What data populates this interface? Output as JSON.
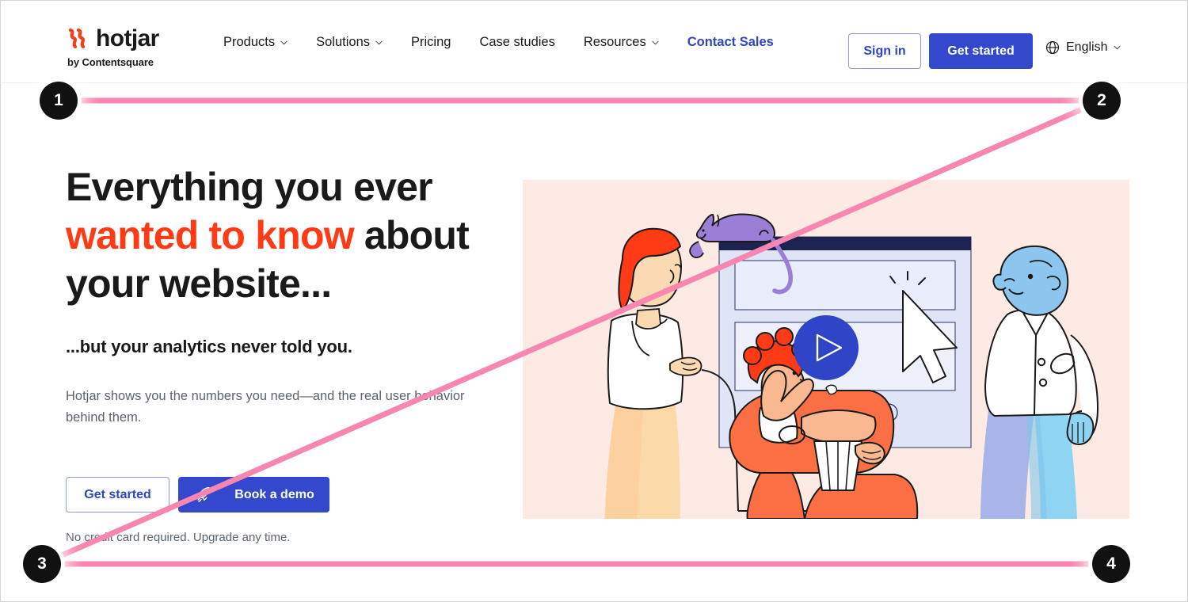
{
  "header": {
    "logo": {
      "mark": "hotjar-flame-icon",
      "wordmark": "hotjar",
      "byline": "by Contentsquare"
    },
    "nav_items": [
      {
        "label": "Products",
        "has_dropdown": true,
        "icon": "chevron-down-icon"
      },
      {
        "label": "Solutions",
        "has_dropdown": true,
        "icon": "chevron-down-icon"
      },
      {
        "label": "Pricing",
        "has_dropdown": false,
        "icon": ""
      },
      {
        "label": "Case studies",
        "has_dropdown": false,
        "icon": ""
      },
      {
        "label": "Resources",
        "has_dropdown": true,
        "icon": "chevron-down-icon"
      },
      {
        "label": "Contact Sales",
        "has_dropdown": false,
        "icon": ""
      }
    ],
    "sign_in_label": "Sign in",
    "get_started_label": "Get started",
    "language": {
      "label": "English",
      "globe_icon": "globe-icon",
      "chevron_icon": "chevron-down-icon"
    }
  },
  "hero": {
    "headline_line1": "Everything you ever",
    "headline_highlight": "wanted to know",
    "headline_line2_tail": " about",
    "headline_line3": "your website...",
    "subheadline": "...but your analytics never told you.",
    "body": "Hotjar shows you the numbers you need—and the real user behavior behind them.",
    "cta_primary_label": "Get started",
    "cta_secondary_label": "Book a demo",
    "cta_secondary_icon": "rocket-icon",
    "fineprint": "No credit card required. Upgrade any time.",
    "image": {
      "alt": "illustration-people-watching-website-video",
      "play_button_icon": "play-icon",
      "background_color": "#fdeae4"
    }
  },
  "annotations": {
    "line_color": "#f786b0",
    "markers": [
      {
        "id": "1",
        "label": "1"
      },
      {
        "id": "2",
        "label": "2"
      },
      {
        "id": "3",
        "label": "3"
      },
      {
        "id": "4",
        "label": "4"
      }
    ]
  },
  "colors": {
    "brand_blue": "#3348cc",
    "link_blue": "#2f44c7",
    "accent_orange": "#ff3b16",
    "text_dark": "#1a1a1a",
    "text_muted": "#5b6270",
    "hero_bg": "#fdeae4",
    "annotation_pink": "#f786b0"
  }
}
